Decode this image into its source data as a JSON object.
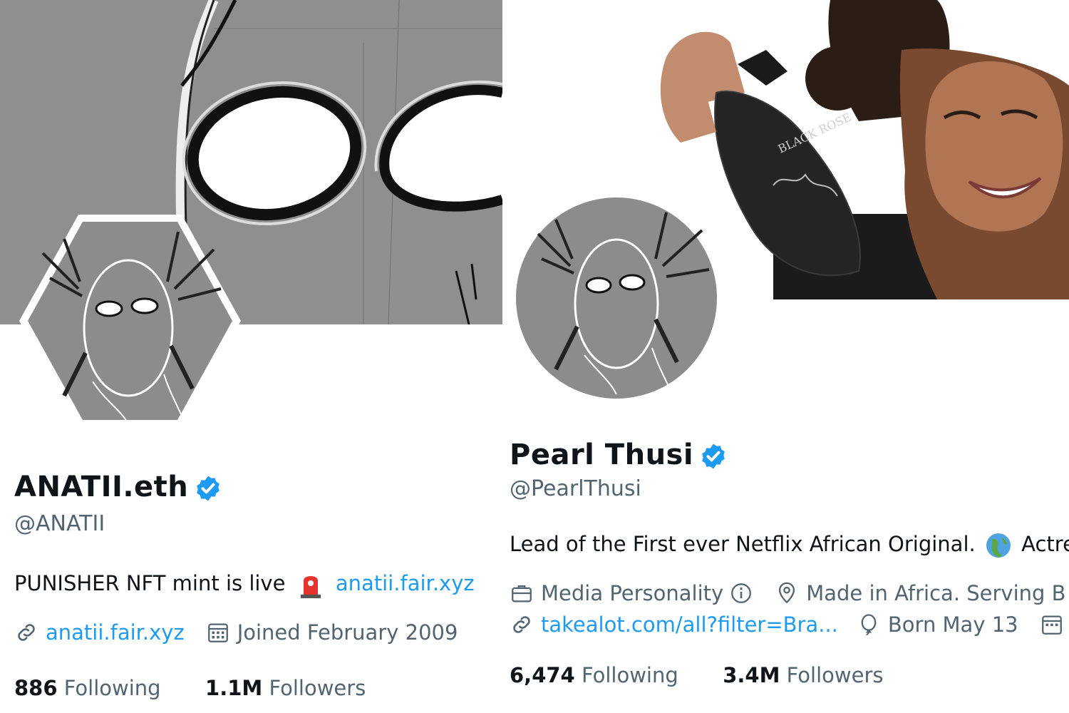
{
  "left_profile": {
    "name": "ANATII.eth",
    "handle": "@ANATII",
    "bio_text": "PUNISHER NFT mint is live",
    "bio_link": "anatii.fair.xyz",
    "website": "anatii.fair.xyz",
    "joined": "Joined February 2009",
    "following_count": "886",
    "following_label": "Following",
    "followers_count": "1.1M",
    "followers_label": "Followers"
  },
  "right_profile": {
    "name": "Pearl Thusi",
    "handle": "@PearlThusi",
    "bio_text": "Lead of the First ever Netflix African Original.",
    "bio_after_icon": "Actre",
    "category": "Media Personality",
    "location": "Made in Africa. Serving B",
    "website": "takealot.com/all?filter=Bra...",
    "born": "Born May 13",
    "following_count": "6,474",
    "following_label": "Following",
    "followers_count": "3.4M",
    "followers_label": "Followers",
    "banner_bottle_text": "BLACK ROSE"
  },
  "colors": {
    "link": "#1d9bf0",
    "verified": "#1d9bf0",
    "secondary_text": "#536471",
    "banner_gray": "#8f8f8f"
  },
  "icons": [
    "verified-icon",
    "siren-icon",
    "link-icon",
    "calendar-icon",
    "briefcase-icon",
    "info-icon",
    "location-icon",
    "globe-icon",
    "balloon-icon"
  ]
}
